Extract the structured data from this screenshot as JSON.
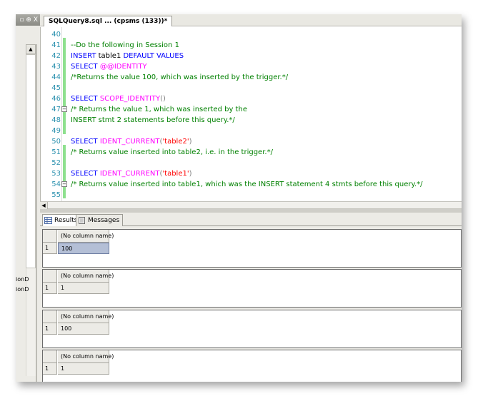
{
  "left_panel": {
    "header_text": "▫ ⊕ X",
    "fragments": [
      "ionD",
      "ionD"
    ]
  },
  "tab": {
    "label": "SQLQuery8.sql ... (cpsms (133))*"
  },
  "editor": {
    "lines": [
      {
        "num": "40",
        "tokens": []
      },
      {
        "num": "41",
        "tokens": [
          {
            "t": "--Do the following in Session 1",
            "c": "cm"
          }
        ]
      },
      {
        "num": "42",
        "tokens": [
          {
            "t": "INSERT",
            "c": "kw"
          },
          {
            "t": " table1 ",
            "c": ""
          },
          {
            "t": "DEFAULT VALUES",
            "c": "kw"
          }
        ]
      },
      {
        "num": "43",
        "tokens": [
          {
            "t": "SELECT",
            "c": "kw"
          },
          {
            "t": " @@IDENTITY",
            "c": "fn"
          }
        ]
      },
      {
        "num": "44",
        "tokens": [
          {
            "t": "/*Returns the value 100, which was inserted by the trigger.*/",
            "c": "cm"
          }
        ]
      },
      {
        "num": "45",
        "tokens": []
      },
      {
        "num": "46",
        "tokens": [
          {
            "t": "SELECT",
            "c": "kw"
          },
          {
            "t": " SCOPE_IDENTITY",
            "c": "fn"
          },
          {
            "t": "()",
            "c": "op"
          }
        ]
      },
      {
        "num": "47",
        "fold": "⊟",
        "tokens": [
          {
            "t": "/* Returns the value 1, which was inserted by the",
            "c": "cm"
          }
        ]
      },
      {
        "num": "48",
        "tokens": [
          {
            "t": "INSERT stmt 2 statements before this query.*/",
            "c": "cm"
          }
        ]
      },
      {
        "num": "49",
        "tokens": []
      },
      {
        "num": "50",
        "tokens": [
          {
            "t": "SELECT",
            "c": "kw"
          },
          {
            "t": " IDENT_CURRENT",
            "c": "fn"
          },
          {
            "t": "(",
            "c": "op"
          },
          {
            "t": "'table2'",
            "c": "str"
          },
          {
            "t": ")",
            "c": "op"
          }
        ]
      },
      {
        "num": "51",
        "tokens": [
          {
            "t": "/* Returns value inserted into table2, i.e. in the trigger.*/",
            "c": "cm"
          }
        ]
      },
      {
        "num": "52",
        "tokens": []
      },
      {
        "num": "53",
        "tokens": [
          {
            "t": "SELECT",
            "c": "kw"
          },
          {
            "t": " IDENT_CURRENT",
            "c": "fn"
          },
          {
            "t": "(",
            "c": "op"
          },
          {
            "t": "'table1'",
            "c": "str"
          },
          {
            "t": ")",
            "c": "op"
          }
        ]
      },
      {
        "num": "54",
        "fold": "⊟",
        "tokens": [
          {
            "t": "/* Returns value inserted into table1, which was the INSERT statement 4 stmts before this query.*/",
            "c": "cm"
          }
        ]
      },
      {
        "num": "55",
        "tokens": []
      }
    ]
  },
  "results_tabs": [
    {
      "label": "Results",
      "icon": "grid-icon",
      "active": true
    },
    {
      "label": "Messages",
      "icon": "document-icon",
      "active": false
    }
  ],
  "result_grids": [
    {
      "column": "(No column name)",
      "row_num": "1",
      "value": "100",
      "selected": true
    },
    {
      "column": "(No column name)",
      "row_num": "1",
      "value": "1",
      "selected": false
    },
    {
      "column": "(No column name)",
      "row_num": "1",
      "value": "100",
      "selected": false
    },
    {
      "column": "(No column name)",
      "row_num": "1",
      "value": "1",
      "selected": false
    }
  ]
}
